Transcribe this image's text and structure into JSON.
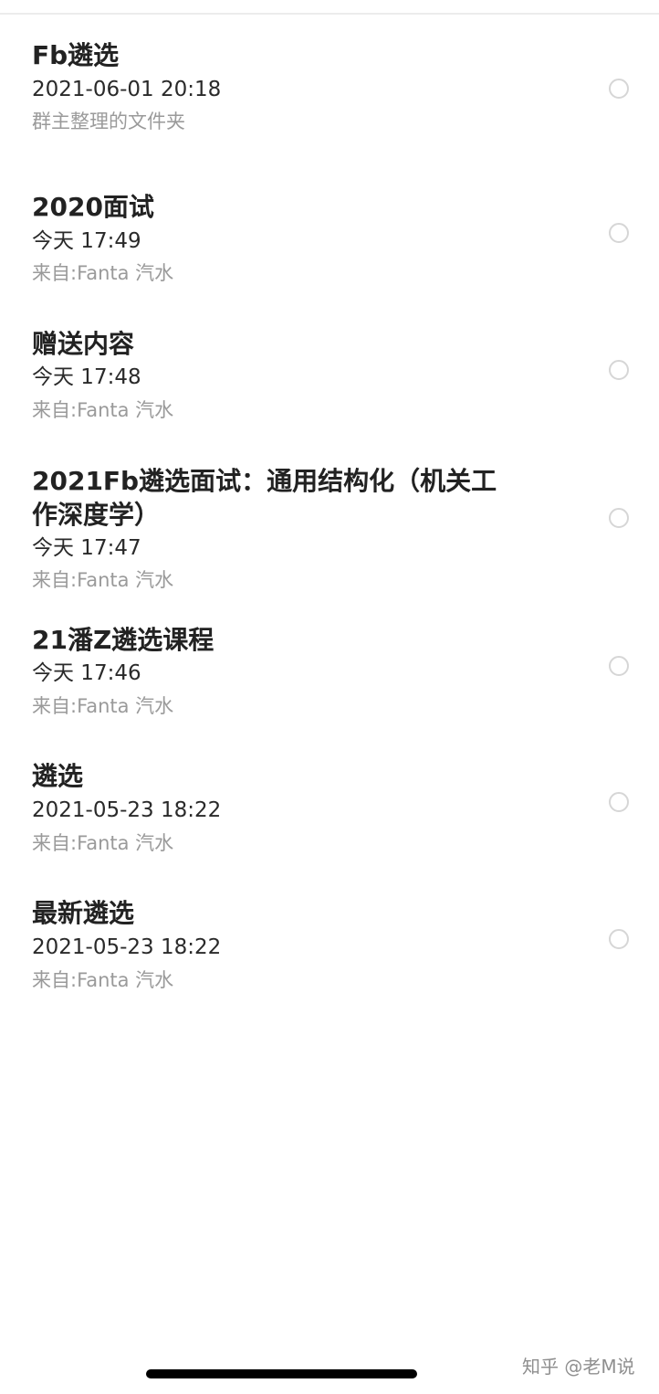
{
  "items": [
    {
      "title": "Fb遴选",
      "date": "2021-06-01 20:18",
      "source": "群主整理的文件夹"
    },
    {
      "title": "2020面试",
      "date": "今天 17:49",
      "source": "来自:Fanta 汽水"
    },
    {
      "title": "赠送内容",
      "date": "今天 17:48",
      "source": "来自:Fanta 汽水"
    },
    {
      "title": "2021Fb遴选面试：通用结构化（机关工作深度学）",
      "date": "今天 17:47",
      "source": "来自:Fanta 汽水"
    },
    {
      "title": "21潘Z遴选课程",
      "date": "今天 17:46",
      "source": "来自:Fanta 汽水"
    },
    {
      "title": "遴选",
      "date": "2021-05-23 18:22",
      "source": "来自:Fanta 汽水"
    },
    {
      "title": "最新遴选",
      "date": "2021-05-23 18:22",
      "source": "来自:Fanta 汽水"
    }
  ],
  "watermark": "知乎 @老M说"
}
